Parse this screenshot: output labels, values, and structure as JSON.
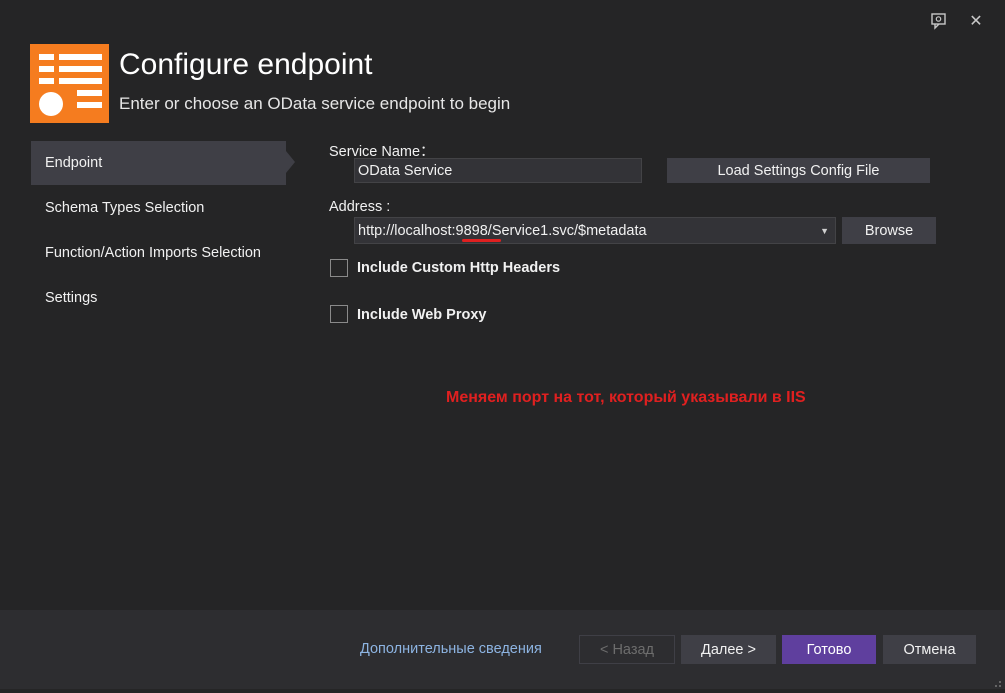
{
  "window": {
    "feedback_icon": "feedback-icon",
    "close_glyph": "✕"
  },
  "header": {
    "title": "Configure endpoint",
    "subtitle": "Enter or choose an OData service endpoint to begin"
  },
  "sidebar": {
    "items": [
      {
        "label": "Endpoint",
        "active": true
      },
      {
        "label": "Schema Types Selection",
        "active": false
      },
      {
        "label": "Function/Action Imports Selection",
        "active": false
      },
      {
        "label": "Settings",
        "active": false
      }
    ]
  },
  "form": {
    "service_name_label": "Service Name：",
    "service_name_value": "OData Service",
    "load_settings_button": "Load Settings Config File",
    "address_label": "Address :",
    "address_value": "http://localhost:9898/Service1.svc/$metadata",
    "browse_button": "Browse",
    "include_headers_label": "Include Custom Http Headers",
    "include_headers_checked": false,
    "include_proxy_label": "Include Web Proxy",
    "include_proxy_checked": false
  },
  "annotation": {
    "text": "Меняем порт на тот, который указывали в IIS",
    "color": "#e02020"
  },
  "footer": {
    "more_info_link": "Дополнительные сведения",
    "back_button": "< Назад",
    "next_button": "Далее >",
    "finish_button": "Готово",
    "cancel_button": "Отмена"
  },
  "colors": {
    "accent": "#f57c1f",
    "primary_button": "#5f3f9e",
    "link": "#8db4e2"
  }
}
